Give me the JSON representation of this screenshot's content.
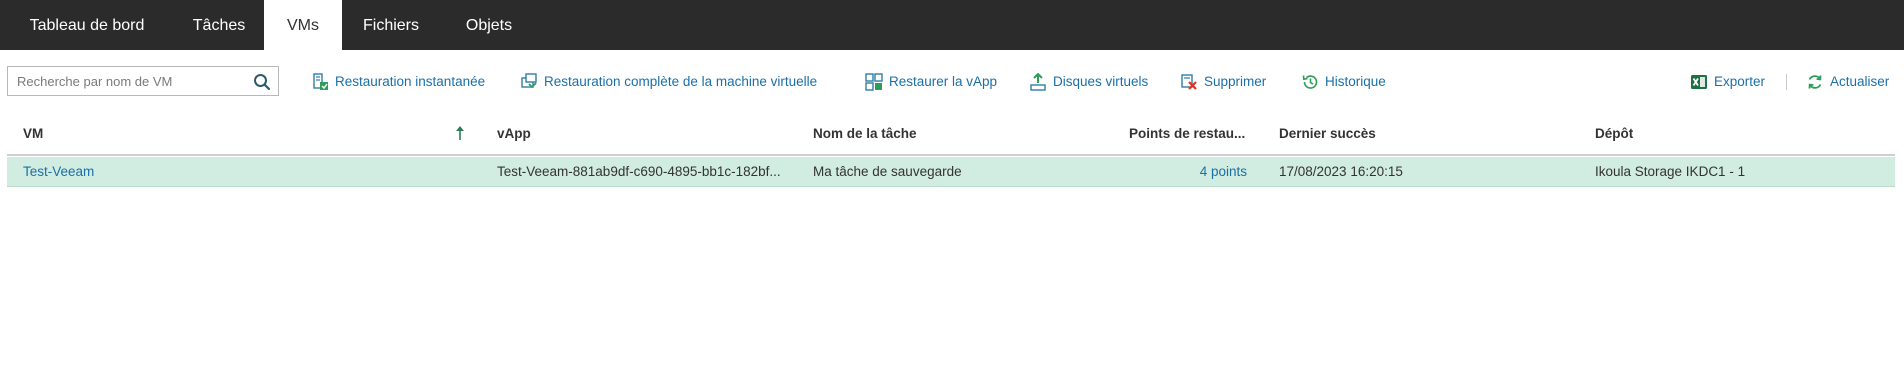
{
  "nav": {
    "tabs": [
      {
        "label": "Tableau de bord"
      },
      {
        "label": "Tâches"
      },
      {
        "label": "VMs",
        "active": true
      },
      {
        "label": "Fichiers"
      },
      {
        "label": "Objets"
      }
    ]
  },
  "toolbar": {
    "search_placeholder": "Recherche par nom de VM",
    "instant_restore": "Restauration instantanée",
    "full_restore": "Restauration complète de la machine virtuelle",
    "restore_vapp": "Restaurer la vApp",
    "virtual_disks": "Disques virtuels",
    "delete": "Supprimer",
    "history": "Historique",
    "export": "Exporter",
    "refresh": "Actualiser"
  },
  "table": {
    "columns": {
      "vm": "VM",
      "vapp": "vApp",
      "job_name": "Nom de la tâche",
      "restore_points": "Points de restau...",
      "last_success": "Dernier succès",
      "repository": "Dépôt"
    },
    "sort": {
      "column": "VM",
      "direction": "ascending"
    },
    "rows": [
      {
        "vm": "Test-Veeam",
        "vapp": "Test-Veeam-881ab9df-c690-4895-bb1c-182bf...",
        "job_name": "Ma tâche de sauvegarde",
        "restore_points": "4 points",
        "last_success": "17/08/2023 16:20:15",
        "repository": "Ikoula Storage IKDC1 - 1"
      }
    ]
  },
  "colors": {
    "nav_bg": "#2b2b2b",
    "link": "#1b6fa8",
    "selected_row": "#d1ece0",
    "icon_green": "#2e9c5a",
    "excel_green": "#1e7145"
  }
}
